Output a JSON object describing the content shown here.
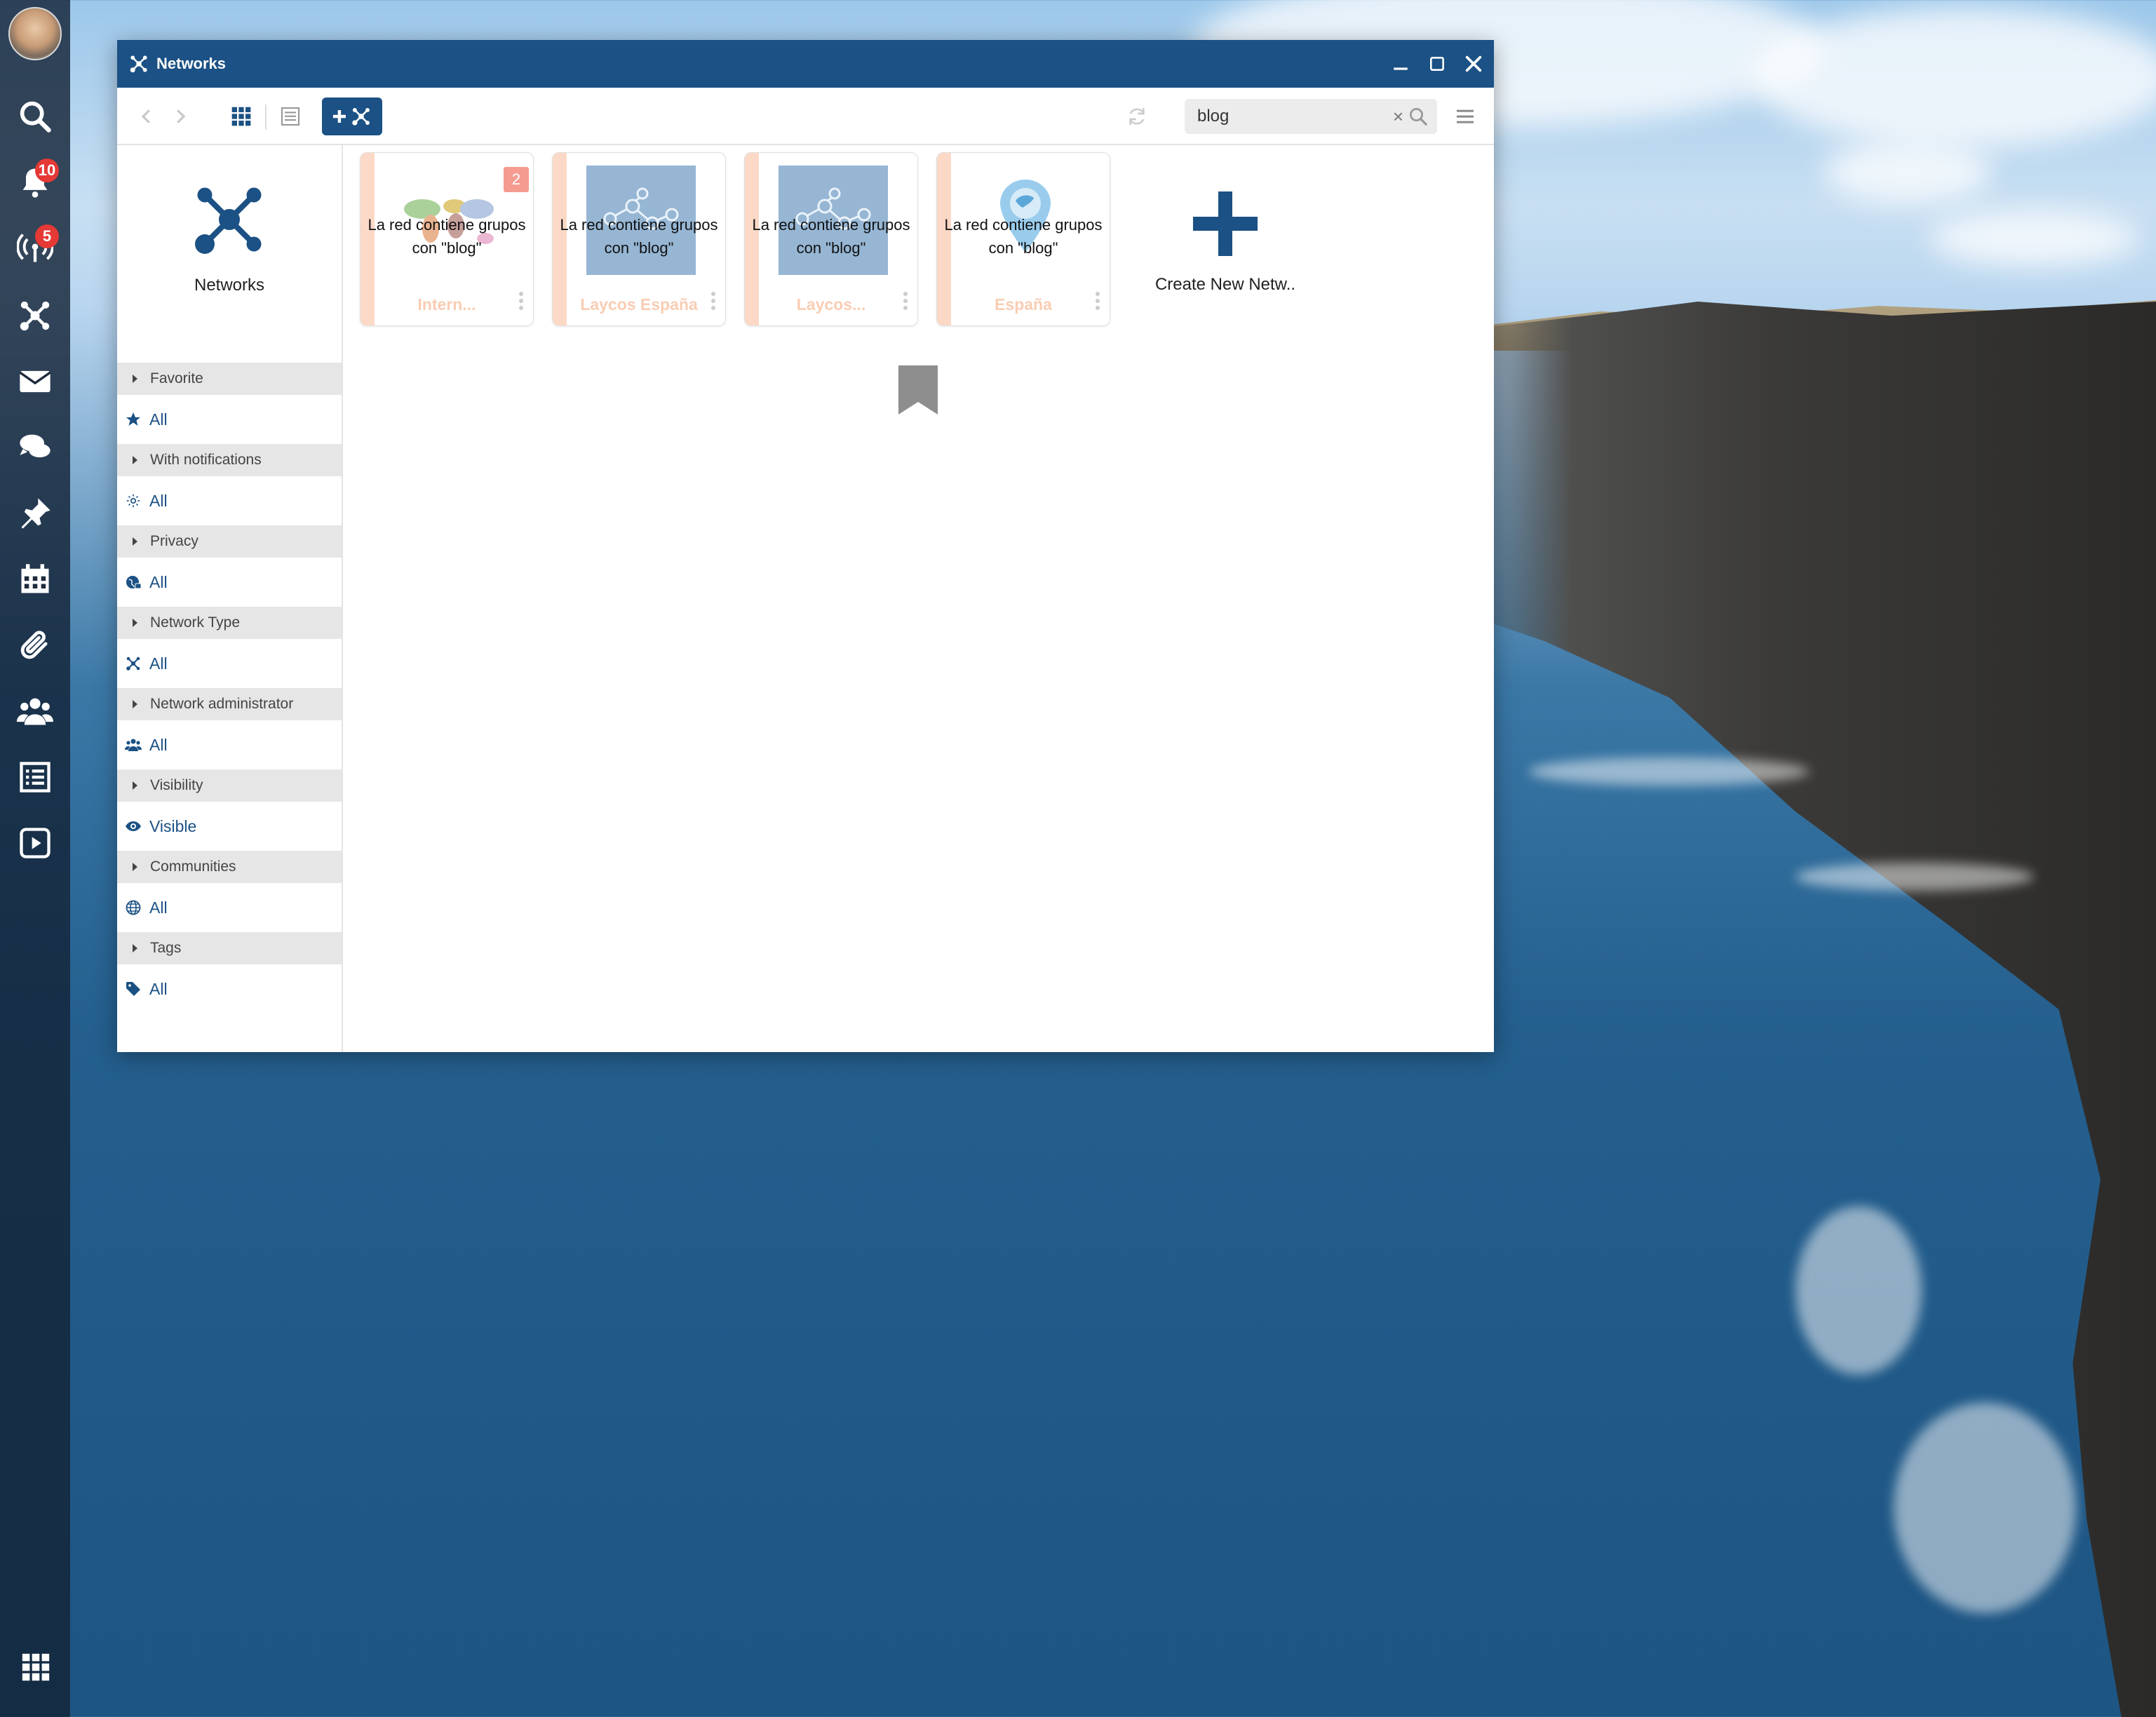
{
  "dock": {
    "items": [
      {
        "icon": "search-icon"
      },
      {
        "icon": "bell-icon",
        "badge": "10"
      },
      {
        "icon": "broadcast-icon",
        "badge": "5"
      },
      {
        "icon": "network-icon"
      },
      {
        "icon": "mail-icon"
      },
      {
        "icon": "chat-icon"
      },
      {
        "icon": "pin-icon"
      },
      {
        "icon": "calendar-icon"
      },
      {
        "icon": "paperclip-icon"
      },
      {
        "icon": "group-icon"
      },
      {
        "icon": "list-icon"
      },
      {
        "icon": "play-icon"
      }
    ],
    "launcher_icon": "apps-grid-icon"
  },
  "window": {
    "title": "Networks",
    "accent": "#1b5184"
  },
  "toolbar": {
    "search_value": "blog",
    "search_clear": "×"
  },
  "sidebar": {
    "header_label": "Networks",
    "filters": [
      {
        "title": "Favorite",
        "value": "All",
        "icon": "star-icon"
      },
      {
        "title": "With notifications",
        "value": "All",
        "icon": "sun-icon"
      },
      {
        "title": "Privacy",
        "value": "All",
        "icon": "globe-lock-icon"
      },
      {
        "title": "Network Type",
        "value": "All",
        "icon": "network-icon"
      },
      {
        "title": "Network administrator",
        "value": "All",
        "icon": "users-icon"
      },
      {
        "title": "Visibility",
        "value": "Visible",
        "icon": "eye-icon"
      },
      {
        "title": "Communities",
        "value": "All",
        "icon": "world-icon"
      },
      {
        "title": "Tags",
        "value": "All",
        "icon": "tag-icon"
      }
    ]
  },
  "cards": [
    {
      "overlay": "La red contiene grupos con \"blog\"",
      "name": "Intern...",
      "count": "2",
      "thumb": "world-map"
    },
    {
      "overlay": "La red contiene grupos con \"blog\"",
      "name": "Laycos España",
      "thumb": "molecule"
    },
    {
      "overlay": "La red contiene grupos con \"blog\"",
      "name": "Laycos...",
      "thumb": "molecule"
    },
    {
      "overlay": "La red contiene grupos con \"blog\"",
      "name": "España",
      "thumb": "pin-map"
    }
  ],
  "create": {
    "label": "Create New Netw.."
  }
}
